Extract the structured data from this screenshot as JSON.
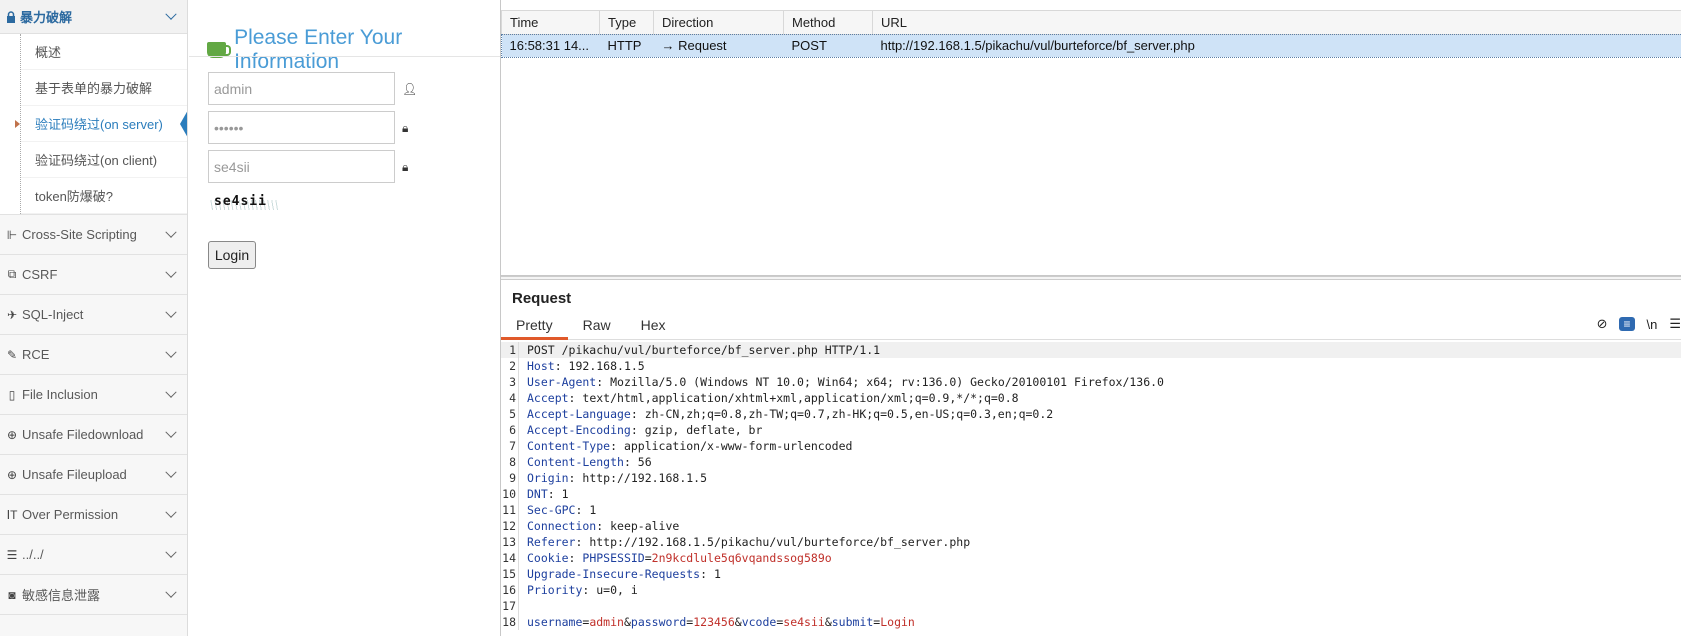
{
  "sidebar": {
    "active_section": "暴力破解",
    "sub_items": [
      {
        "label": "概述",
        "active": false
      },
      {
        "label": "基于表单的暴力破解",
        "active": false
      },
      {
        "label": "验证码绕过(on server)",
        "active": true
      },
      {
        "label": "验证码绕过(on client)",
        "active": false
      },
      {
        "label": "token防爆破?",
        "active": false
      }
    ],
    "items": [
      {
        "label": "Cross-Site Scripting",
        "icon": "xss-icon"
      },
      {
        "label": "CSRF",
        "icon": "share-icon"
      },
      {
        "label": "SQL-Inject",
        "icon": "plane-icon"
      },
      {
        "label": "RCE",
        "icon": "pencil-icon"
      },
      {
        "label": "File Inclusion",
        "icon": "file-icon"
      },
      {
        "label": "Unsafe Filedownload",
        "icon": "download-icon"
      },
      {
        "label": "Unsafe Fileupload",
        "icon": "upload-icon"
      },
      {
        "label": "Over Permission",
        "icon": "text-height-icon"
      },
      {
        "label": "../../",
        "icon": "align-left-icon"
      },
      {
        "label": "敏感信息泄露",
        "icon": "camera-icon"
      }
    ]
  },
  "form": {
    "title": "Please Enter Your Information",
    "username_value": "admin",
    "password_value": "••••••",
    "vcode_value": "se4sii",
    "captcha_text": "se4sii",
    "login_label": "Login"
  },
  "history": {
    "columns": [
      "Time",
      "Type",
      "Direction",
      "Method",
      "URL"
    ],
    "rows": [
      {
        "time": "16:58:31 14...",
        "type": "HTTP",
        "direction": "→  Request",
        "method": "POST",
        "url": "http://192.168.1.5/pikachu/vul/burteforce/bf_server.php"
      }
    ]
  },
  "request": {
    "title": "Request",
    "tabs": [
      "Pretty",
      "Raw",
      "Hex"
    ],
    "active_tab": "Pretty",
    "tools": {
      "newline": "\\n"
    },
    "first_line": "POST /pikachu/vul/burteforce/bf_server.php HTTP/1.1",
    "headers": [
      {
        "name": "Host",
        "value": "192.168.1.5"
      },
      {
        "name": "User-Agent",
        "value": "Mozilla/5.0 (Windows NT 10.0; Win64; x64; rv:136.0) Gecko/20100101 Firefox/136.0"
      },
      {
        "name": "Accept",
        "value": "text/html,application/xhtml+xml,application/xml;q=0.9,*/*;q=0.8"
      },
      {
        "name": "Accept-Language",
        "value": "zh-CN,zh;q=0.8,zh-TW;q=0.7,zh-HK;q=0.5,en-US;q=0.3,en;q=0.2"
      },
      {
        "name": "Accept-Encoding",
        "value": "gzip, deflate, br"
      },
      {
        "name": "Content-Type",
        "value": "application/x-www-form-urlencoded"
      },
      {
        "name": "Content-Length",
        "value": "56"
      },
      {
        "name": "Origin",
        "value": "http://192.168.1.5"
      },
      {
        "name": "DNT",
        "value": "1"
      },
      {
        "name": "Sec-GPC",
        "value": "1"
      },
      {
        "name": "Connection",
        "value": "keep-alive"
      },
      {
        "name": "Referer",
        "value": "http://192.168.1.5/pikachu/vul/burteforce/bf_server.php"
      },
      {
        "name": "Cookie",
        "value": "PHPSESSID=2n9kcdlule5q6vqandssog589o"
      },
      {
        "name": "Upgrade-Insecure-Requests",
        "value": "1"
      },
      {
        "name": "Priority",
        "value": "u=0, i"
      }
    ],
    "body_params": [
      {
        "key": "username",
        "val": "admin"
      },
      {
        "key": "password",
        "val": "123456"
      },
      {
        "key": "vcode",
        "val": "se4sii"
      },
      {
        "key": "submit",
        "val": "Login"
      }
    ]
  },
  "colors": {
    "accent": "#2b7dbc",
    "selection": "#cfe3f7",
    "tab_active": "#e0592a",
    "header_name": "#1d3f9e",
    "param_value": "#c0302a"
  }
}
